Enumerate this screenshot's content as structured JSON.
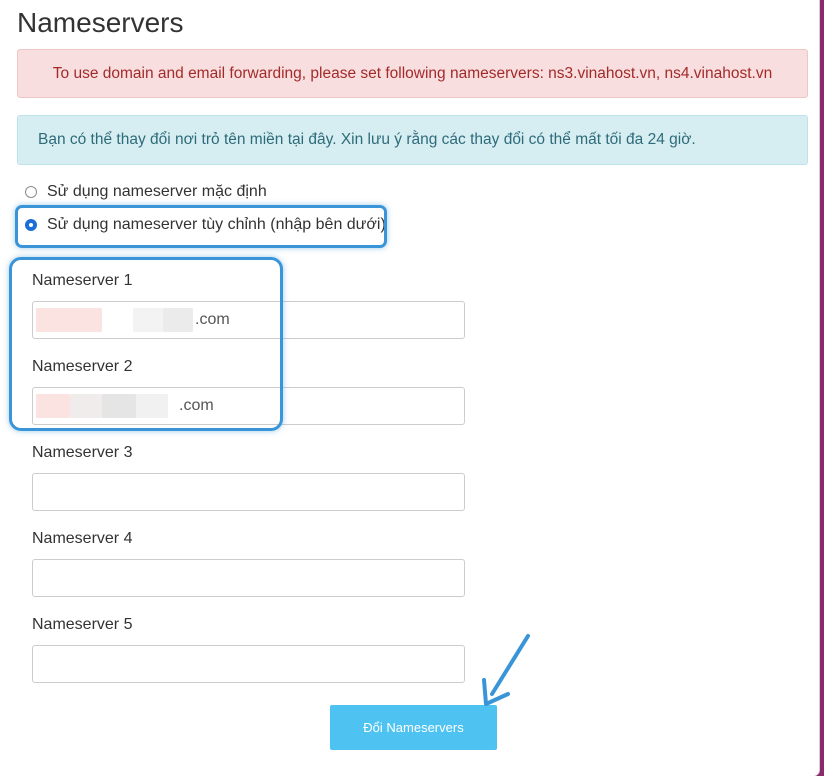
{
  "page": {
    "title": "Nameservers"
  },
  "alerts": {
    "danger": "To use domain and email forwarding, please set following nameservers: ns3.vinahost.vn, ns4.vinahost.vn",
    "info": "Bạn có thể thay đổi nơi trỏ tên miền tại đây. Xin lưu ý rằng các thay đổi có thể mất tối đa 24 giờ."
  },
  "options": [
    {
      "label": "Sử dụng nameserver mặc định",
      "checked": false
    },
    {
      "label": "Sử dụng nameserver tùy chỉnh (nhập bên dưới)",
      "checked": true
    }
  ],
  "nameservers": [
    {
      "label": "Nameserver 1",
      "visible_suffix": ".com"
    },
    {
      "label": "Nameserver 2",
      "visible_suffix": ".com"
    },
    {
      "label": "Nameserver 3",
      "visible_suffix": ""
    },
    {
      "label": "Nameserver 4",
      "visible_suffix": ""
    },
    {
      "label": "Nameserver 5",
      "visible_suffix": ""
    }
  ],
  "submit": {
    "label": "Đổi Nameservers"
  },
  "colors": {
    "highlight": "#3a95d8",
    "button": "#4ec3f2",
    "danger_bg": "#f8dede",
    "info_bg": "#d6eef2"
  }
}
